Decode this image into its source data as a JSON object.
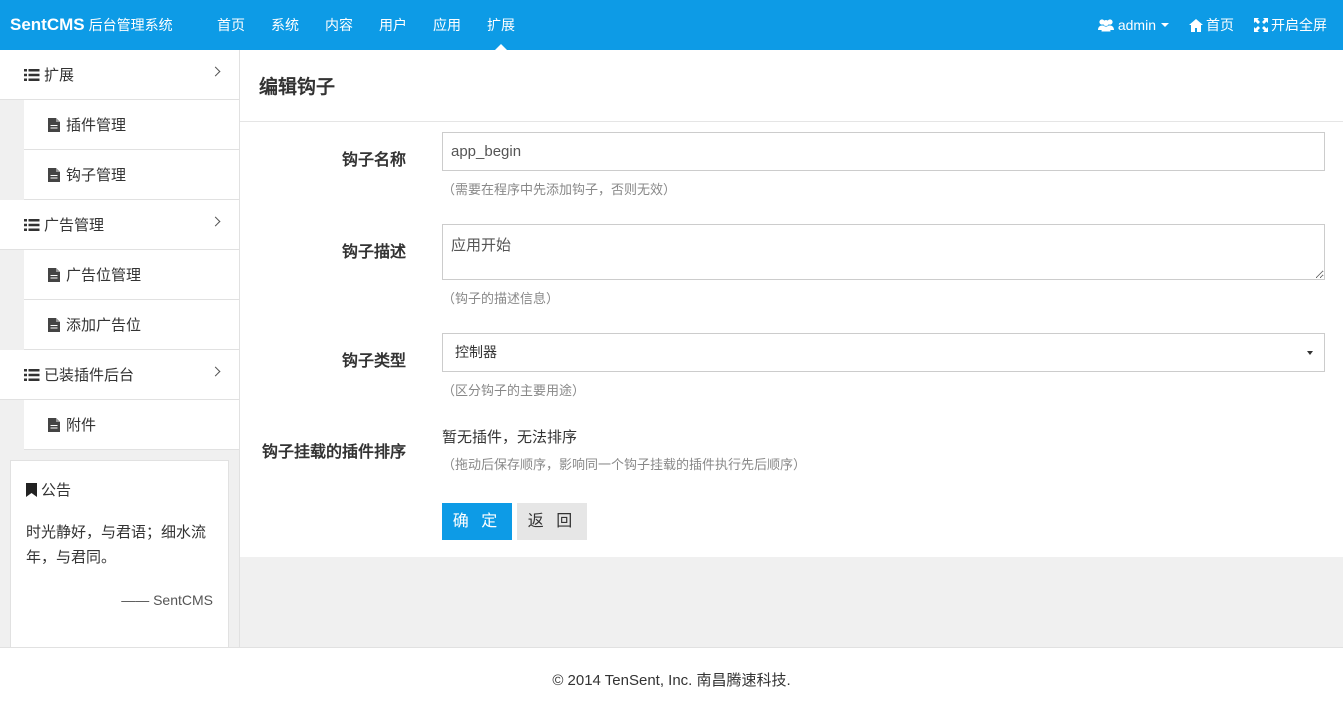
{
  "brand": {
    "name": "SentCMS",
    "subtitle": "后台管理系统"
  },
  "nav": {
    "items": [
      {
        "label": "首页"
      },
      {
        "label": "系统"
      },
      {
        "label": "内容"
      },
      {
        "label": "用户"
      },
      {
        "label": "应用"
      },
      {
        "label": "扩展"
      }
    ],
    "active_index": 5,
    "right": {
      "user": "admin",
      "home": "首页",
      "fullscreen": "开启全屏"
    }
  },
  "sidebar": {
    "groups": [
      {
        "label": "扩展",
        "items": [
          {
            "label": "插件管理"
          },
          {
            "label": "钩子管理"
          }
        ]
      },
      {
        "label": "广告管理",
        "items": [
          {
            "label": "广告位管理"
          },
          {
            "label": "添加广告位"
          }
        ]
      },
      {
        "label": "已装插件后台",
        "items": [
          {
            "label": "附件"
          }
        ]
      }
    ],
    "notice": {
      "title": "公告",
      "body": "时光静好，与君语；细水流年，与君同。",
      "sign": "—— SentCMS"
    }
  },
  "page": {
    "title": "编辑钩子",
    "fields": {
      "name": {
        "label": "钩子名称",
        "value": "app_begin",
        "help": "（需要在程序中先添加钩子，否则无效）"
      },
      "description": {
        "label": "钩子描述",
        "value": "应用开始",
        "help": "（钩子的描述信息）"
      },
      "type": {
        "label": "钩子类型",
        "value": "控制器",
        "help": "（区分钩子的主要用途）"
      },
      "order": {
        "label": "钩子挂载的插件排序",
        "value": "暂无插件，无法排序",
        "help": "（拖动后保存顺序，影响同一个钩子挂载的插件执行先后顺序）"
      }
    },
    "buttons": {
      "submit": "确 定",
      "back": "返 回"
    }
  },
  "footer": {
    "text": "© 2014 TenSent, Inc. 南昌腾速科技."
  },
  "colors": {
    "primary": "#0d9be6",
    "sidebar_bg": "#f0f0f0",
    "help_text": "#888888"
  }
}
